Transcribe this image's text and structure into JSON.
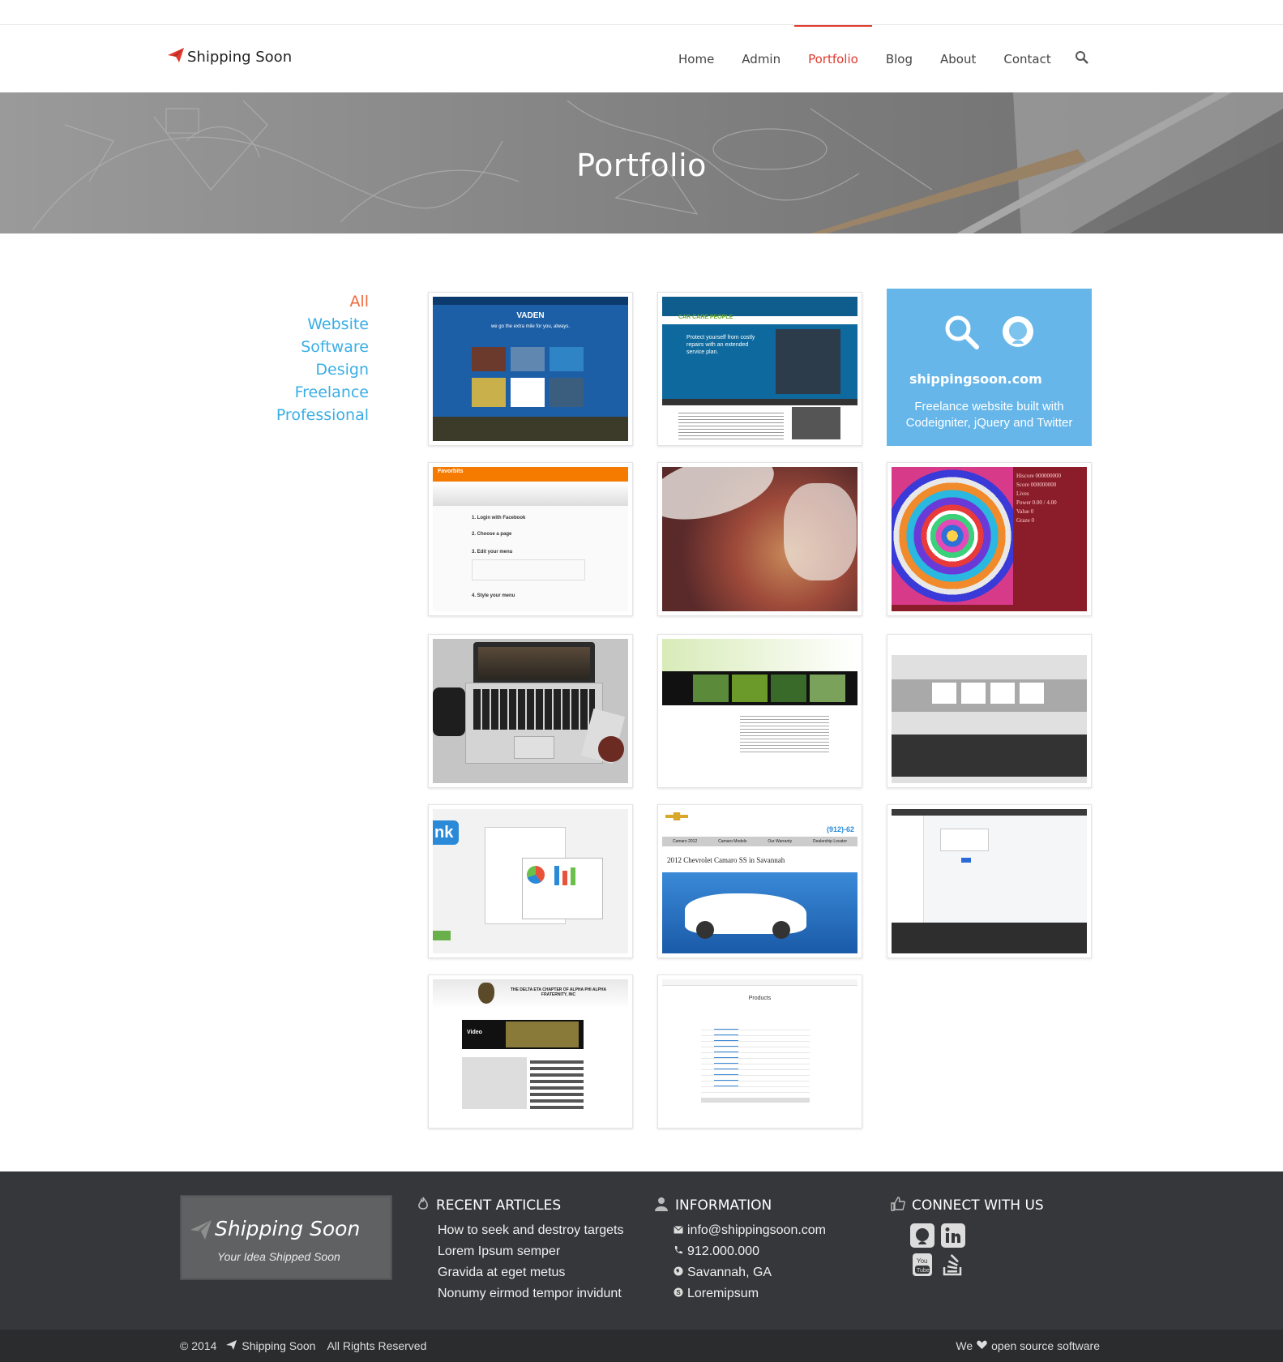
{
  "header": {
    "logo_text": "Shipping Soon",
    "nav": [
      {
        "label": "Home"
      },
      {
        "label": "Admin"
      },
      {
        "label": "Portfolio",
        "active": true
      },
      {
        "label": "Blog"
      },
      {
        "label": "About"
      },
      {
        "label": "Contact"
      }
    ],
    "search_icon": "search-icon",
    "accent_color": "#e03a2e"
  },
  "banner": {
    "title": "Portfolio"
  },
  "filters": {
    "items": [
      "All",
      "Website",
      "Software",
      "Design",
      "Freelance",
      "Professional"
    ],
    "active": "All",
    "active_color": "#f06a3c",
    "link_color": "#3aaee6"
  },
  "portfolio": {
    "hover_item": {
      "site": "shippingsoon.com",
      "description": "Freelance website built with Codeigniter, jQuery and Twitter",
      "icons": [
        "magnifier-icon",
        "github-icon"
      ]
    },
    "tiles": [
      {
        "name": "vaden-website-thumb"
      },
      {
        "name": "car-care-people-thumb"
      },
      {
        "name": "shippingsoon-thumb"
      },
      {
        "name": "favorbits-thumb"
      },
      {
        "name": "portrait-photo-thumb"
      },
      {
        "name": "colorful-game-thumb"
      },
      {
        "name": "laptop-desk-thumb"
      },
      {
        "name": "nature-website-thumb"
      },
      {
        "name": "vaden-used-cars-thumb"
      },
      {
        "name": "dashboard-charts-thumb"
      },
      {
        "name": "chevrolet-camaro-thumb"
      },
      {
        "name": "admin-panel-thumb"
      },
      {
        "name": "fraternity-website-thumb"
      },
      {
        "name": "products-table-thumb"
      }
    ],
    "thumb_text": {
      "vaden": "VADEN",
      "vaden_tag": "we go the extra mile for you, always.",
      "carcare": "CAR CARE PEOPLE",
      "carcare_msg": "Protect yourself from costly repairs with an extended service plan.",
      "favorbits": "Favorbits",
      "favor_steps": [
        "1. Login with Facebook",
        "2. Choose a page",
        "3. Edit your menu",
        "4. Style your menu"
      ],
      "game_stats": [
        "Hiscore 000000000",
        "Score 000000000",
        "Lives",
        "Power 0.00 / 4.00",
        "Value 0",
        "Graze 0"
      ],
      "camaro_title": "2012 Chevrolet Camaro SS in Savannah",
      "camaro_phone": "(912)-62",
      "camaro_tabs": [
        "Camaro 2012",
        "Camaro Models",
        "Our Warranty",
        "Dealership Locator"
      ],
      "frat_title": "THE DELTA ETA CHAPTER OF ALPHA PHI ALPHA FRATERNITY, INC",
      "frat_video": "Video",
      "products_title": "Products",
      "dash_logo": "nk"
    }
  },
  "footer": {
    "logo_name": "Shipping Soon",
    "logo_tagline": "Your Idea Shipped Soon",
    "recent": {
      "title": "RECENT ARTICLES",
      "items": [
        "How to seek and destroy targets",
        "Lorem Ipsum semper",
        "Gravida at eget metus",
        "Nonumy eirmod tempor invidunt"
      ]
    },
    "info": {
      "title": "INFORMATION",
      "email": "info@shippingsoon.com",
      "phone": "912.000.000",
      "location": "Savannah, GA",
      "skype": "Loremipsum"
    },
    "connect": {
      "title": "CONNECT WITH US",
      "icons": [
        "github-icon",
        "linkedin-icon",
        "youtube-icon",
        "stackoverflow-icon"
      ]
    }
  },
  "bottom": {
    "year": "© 2014",
    "brand": "Shipping Soon",
    "rights": "All Rights Reserved",
    "we": "We",
    "oss": "open source software"
  }
}
